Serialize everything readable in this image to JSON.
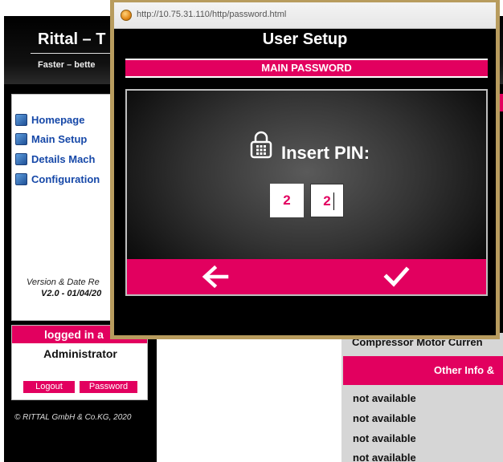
{
  "background": {
    "app_title": "Rittal – T",
    "tagline": "Faster – bette",
    "nav": [
      {
        "label": "Homepage",
        "icon": "home-icon"
      },
      {
        "label": "Main Setup",
        "icon": "setup-icon"
      },
      {
        "label": "Details Mach",
        "icon": "details-icon"
      },
      {
        "label": "Configuration",
        "icon": "configuration-icon"
      }
    ],
    "version_label": "Version & Date Re",
    "version_value": "V2.0 - 01/04/20",
    "login_header": "logged in a",
    "user": "Administrator",
    "logout_label": "Logout",
    "password_label": "Password",
    "copyright": "© RITTAL GmbH & Co.KG, 2020",
    "compressor_label": "Compressor Motor Curren",
    "other_info_label": "Other Info &",
    "rows": [
      "not available",
      "not available",
      "not available",
      "not available"
    ]
  },
  "popup": {
    "url": "http://10.75.31.110/http/password.html",
    "title": "User Setup",
    "section": "MAIN PASSWORD",
    "prompt": "Insert PIN:",
    "pin_digits": [
      "2",
      "2"
    ],
    "accent_color": "#e2005f",
    "icons": {
      "lock": "lock-icon",
      "back": "arrow-left-icon",
      "confirm": "checkmark-icon",
      "site": "globe-icon"
    }
  }
}
